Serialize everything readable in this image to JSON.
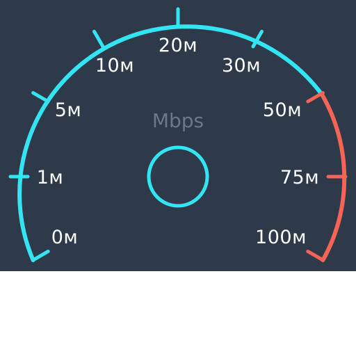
{
  "gauge": {
    "unit": "Mbps",
    "labels": [
      "0м",
      "1м",
      "5м",
      "10м",
      "20м",
      "30м",
      "50м",
      "75м",
      "100м"
    ],
    "colors": {
      "background": "#2e3a4a",
      "normal": "#33e4f2",
      "danger": "#f56454",
      "label": "#ffffff",
      "unit": "#6d7886"
    }
  }
}
